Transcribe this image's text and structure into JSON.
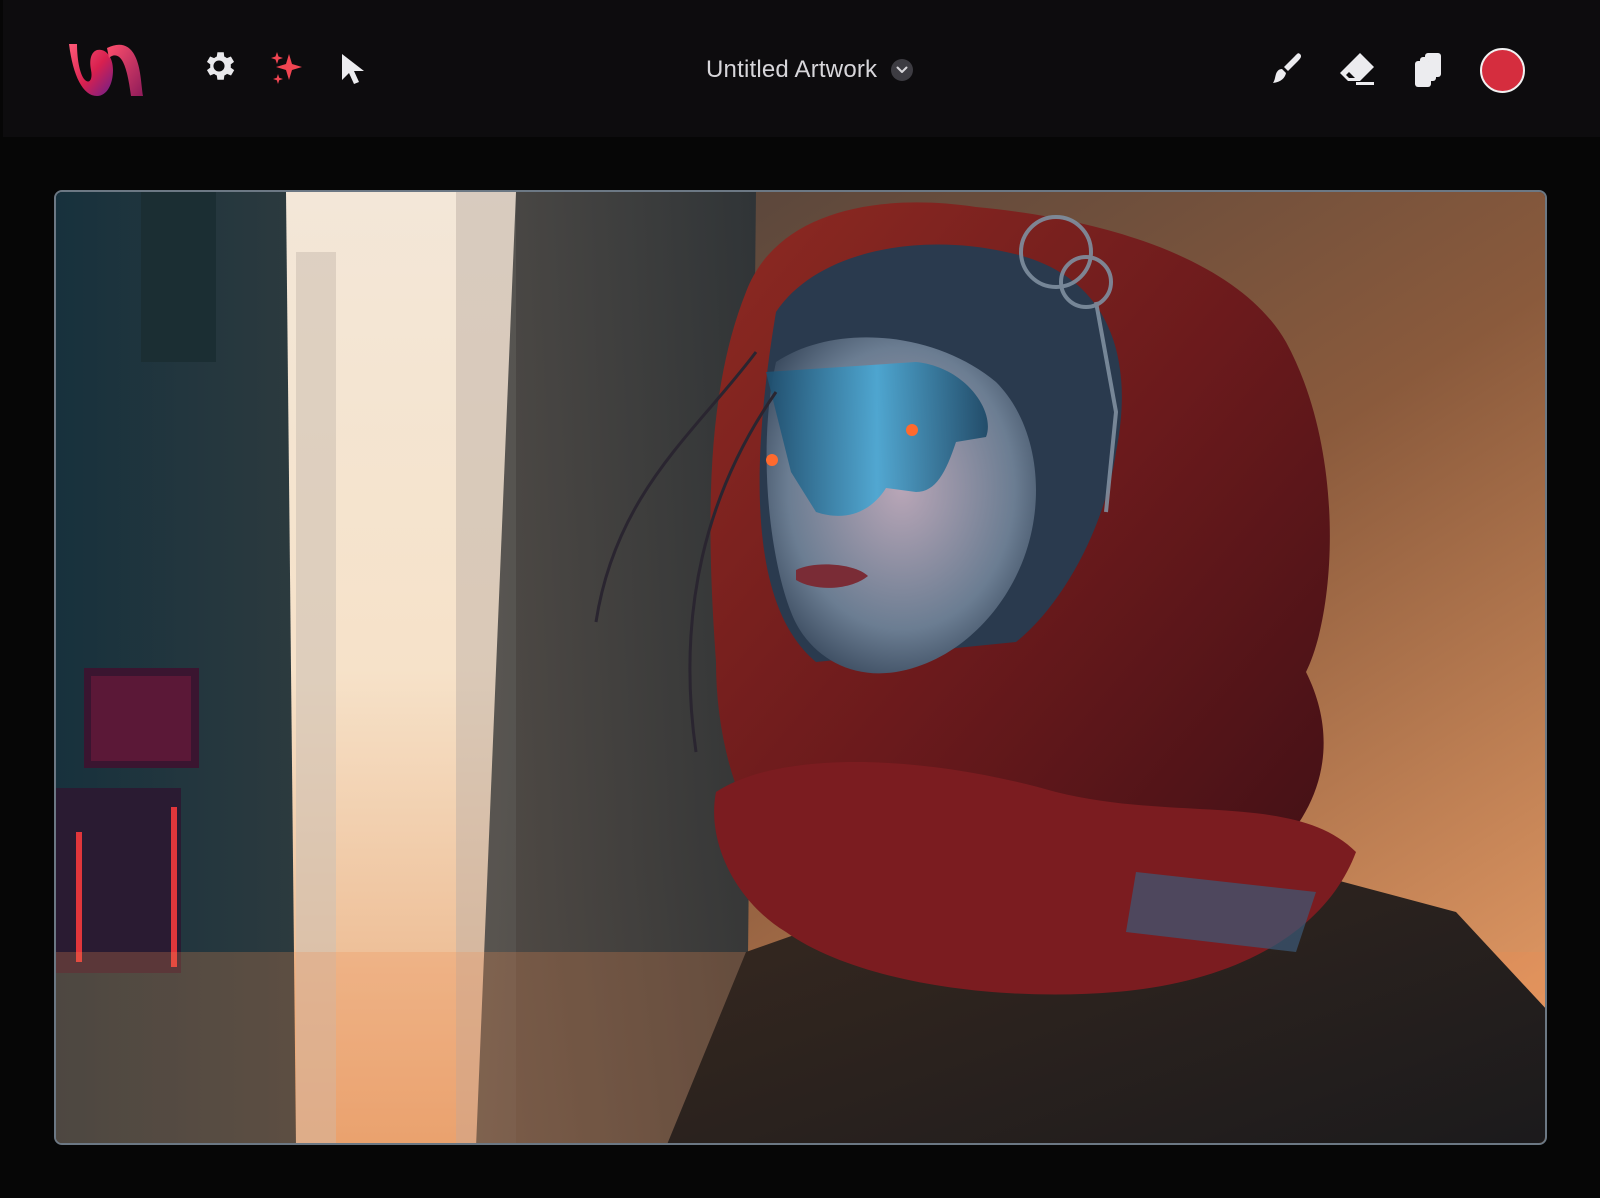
{
  "app": {
    "logo_name": "app-logo",
    "brand_colors": [
      "#ff4a6d",
      "#c2174d",
      "#5b1da2"
    ]
  },
  "toolbar": {
    "left_tools": [
      {
        "name": "settings",
        "icon": "gear-icon"
      },
      {
        "name": "ai-generate",
        "icon": "sparkle-icon",
        "color": "#f14552"
      },
      {
        "name": "select",
        "icon": "cursor-arrow-icon"
      }
    ],
    "right_tools": [
      {
        "name": "brush",
        "icon": "brush-icon"
      },
      {
        "name": "eraser",
        "icon": "eraser-icon"
      },
      {
        "name": "layers",
        "icon": "layers-icon"
      }
    ],
    "current_color": "#d52d3e"
  },
  "document": {
    "title": "Untitled Artwork",
    "title_menu_icon": "chevron-down-icon"
  },
  "canvas": {
    "content": "artwork-image",
    "border_color": "#6c7884"
  }
}
